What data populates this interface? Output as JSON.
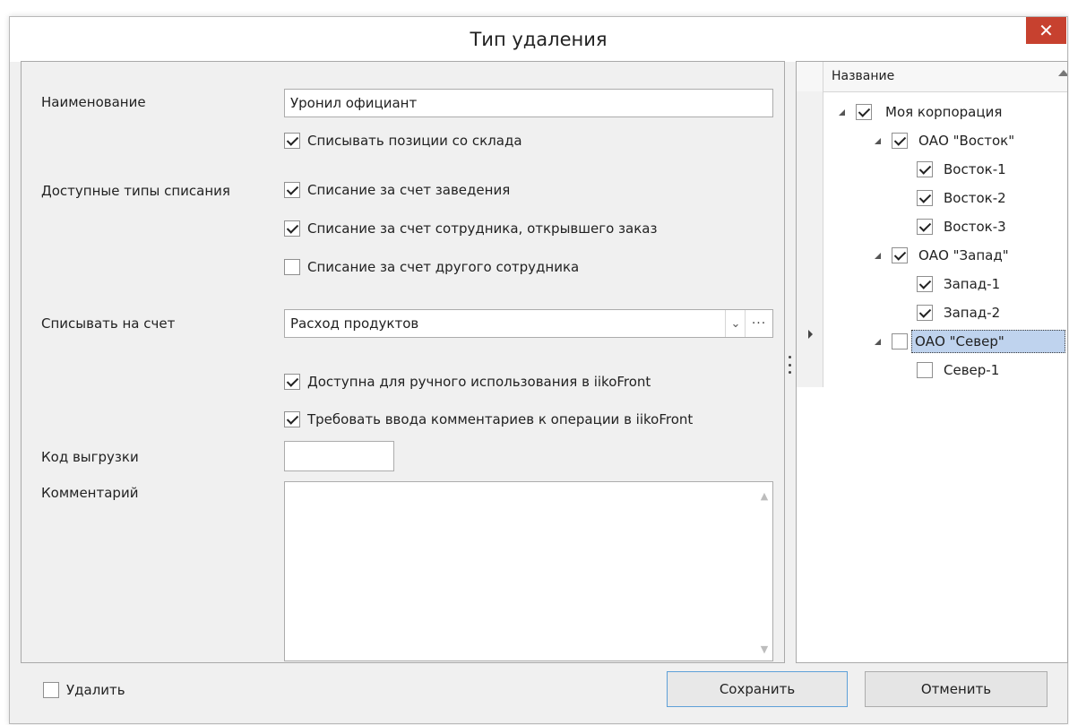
{
  "window": {
    "title": "Тип удаления",
    "close_glyph": "✕"
  },
  "form": {
    "name_label": "Наименование",
    "name_value": "Уронил официант",
    "write_off_stock_label": "Списывать позиции со склада",
    "write_off_stock_checked": true,
    "types_label": "Доступные типы списания",
    "types": [
      {
        "label": "Списание за счет заведения",
        "checked": true
      },
      {
        "label": "Списание за счет сотрудника, открывшего заказ",
        "checked": true
      },
      {
        "label": "Списание за счет другого сотрудника",
        "checked": false
      }
    ],
    "account_label": "Списывать на счет",
    "account_value": "Расход продуктов",
    "manual_use_label": "Доступна для ручного использования в iikoFront",
    "manual_use_checked": true,
    "require_comment_label": "Требовать ввода комментариев к операции в iikoFront",
    "require_comment_checked": true,
    "export_code_label": "Код выгрузки",
    "export_code_value": "",
    "comment_label": "Комментарий",
    "comment_value": ""
  },
  "tree": {
    "column_title": "Название",
    "nodes": [
      {
        "label": "Моя корпорация",
        "checked": true,
        "level": 0,
        "expanded": true
      },
      {
        "label": "ОАО \"Восток\"",
        "checked": true,
        "level": 1,
        "expanded": true
      },
      {
        "label": "Восток-1",
        "checked": true,
        "level": 2
      },
      {
        "label": "Восток-2",
        "checked": true,
        "level": 2
      },
      {
        "label": "Восток-3",
        "checked": true,
        "level": 2
      },
      {
        "label": "ОАО \"Запад\"",
        "checked": true,
        "level": 1,
        "expanded": true
      },
      {
        "label": "Запад-1",
        "checked": true,
        "level": 2
      },
      {
        "label": "Запад-2",
        "checked": true,
        "level": 2
      },
      {
        "label": "ОАО \"Север\"",
        "checked": false,
        "level": 1,
        "expanded": true,
        "selected": true
      },
      {
        "label": "Север-1",
        "checked": false,
        "level": 2
      }
    ]
  },
  "footer": {
    "delete_label": "Удалить",
    "delete_checked": false,
    "save_label": "Сохранить",
    "cancel_label": "Отменить"
  },
  "colors": {
    "close_button": "#c7412f",
    "selection": "#bfd3ee",
    "primary_border": "#5ea0d8"
  }
}
